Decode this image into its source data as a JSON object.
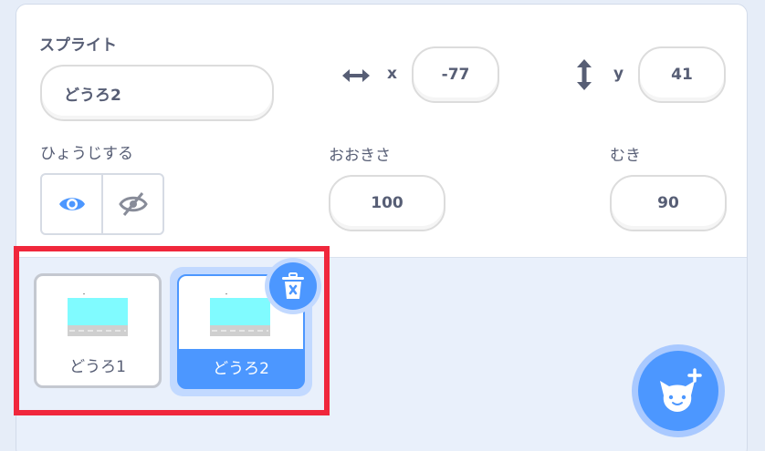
{
  "sprite_info": {
    "sprite_label": "スプライト",
    "sprite_name": "どうろ2",
    "x_label": "x",
    "x_value": "-77",
    "y_label": "y",
    "y_value": "41",
    "show_label": "ひょうじする",
    "size_label": "おおきさ",
    "size_value": "100",
    "direction_label": "むき",
    "direction_value": "90"
  },
  "sprites": [
    {
      "name": "どうろ1",
      "selected": false
    },
    {
      "name": "どうろ2",
      "selected": true
    }
  ],
  "icons": {
    "horizontal": "horizontal-arrows-icon",
    "vertical": "vertical-arrows-icon",
    "show": "eye-icon",
    "hide": "eye-slash-icon",
    "delete": "trash-icon",
    "add_sprite": "cat-plus-icon"
  },
  "colors": {
    "accent": "#4c97ff",
    "highlight": "#f0273c",
    "road_sky": "#80fbff",
    "road_ground": "#cfcfcf"
  }
}
